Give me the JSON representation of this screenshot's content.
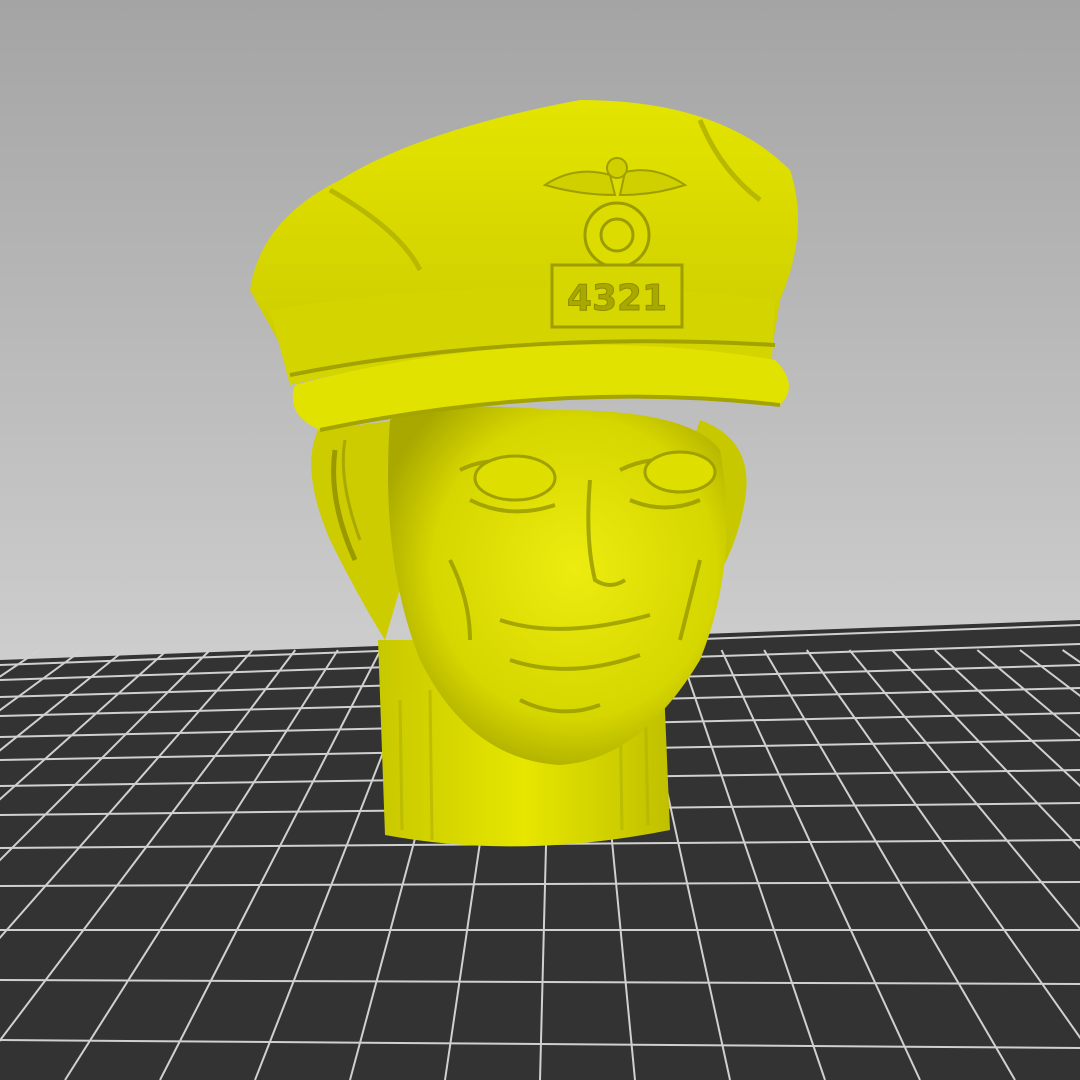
{
  "viewport": {
    "background_top": "#a2a2a2",
    "background_bottom": "#e6e6e6",
    "bed_fill": "#323232",
    "grid_line": "#d2d2d2"
  },
  "model": {
    "color": "#e6e600",
    "shade": "#b4b400",
    "badge_number": "4321"
  }
}
